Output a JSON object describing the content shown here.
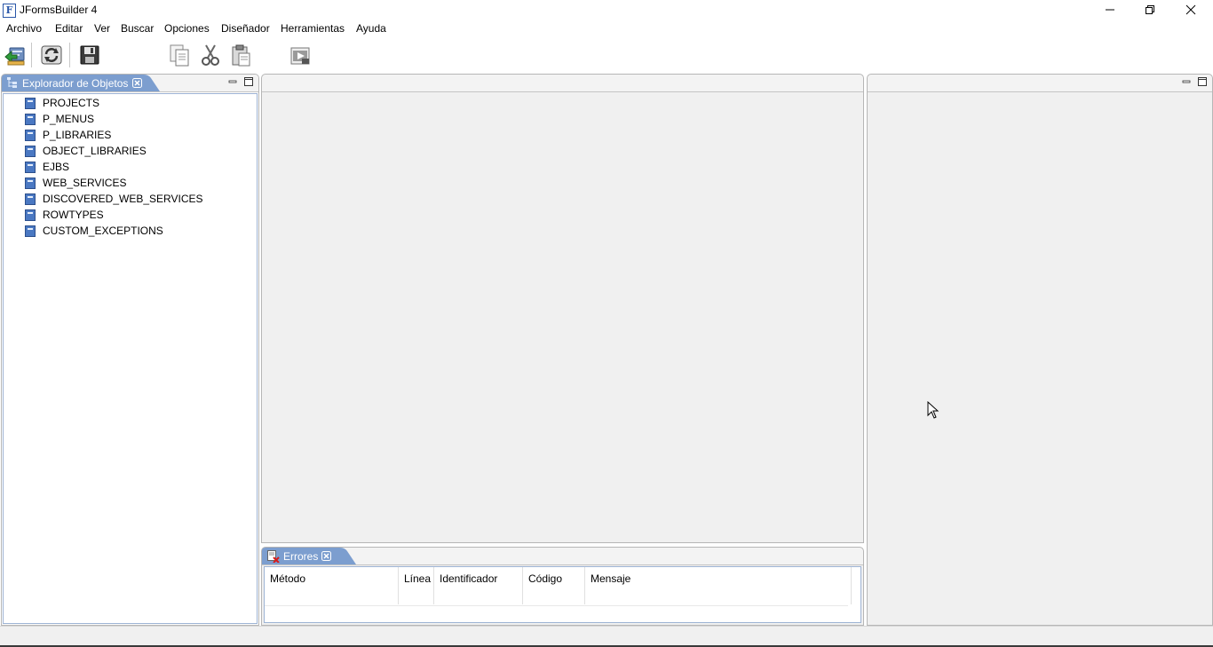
{
  "window": {
    "title": "JFormsBuilder 4",
    "app_icon_letter": "F"
  },
  "menu": {
    "items": [
      "Archivo",
      "Editar",
      "Ver",
      "Buscar",
      "Opciones",
      "Diseñador",
      "Herramientas",
      "Ayuda"
    ]
  },
  "toolbar": {
    "buttons": [
      "open-project-icon",
      "refresh-icon",
      "save-icon",
      "copy-icon",
      "cut-icon",
      "paste-icon",
      "run-form-icon"
    ]
  },
  "explorer": {
    "tab_label": "Explorador de Objetos",
    "items": [
      "PROJECTS",
      "P_MENUS",
      "P_LIBRARIES",
      "OBJECT_LIBRARIES",
      "EJBS",
      "WEB_SERVICES",
      "DISCOVERED_WEB_SERVICES",
      "ROWTYPES",
      "CUSTOM_EXCEPTIONS"
    ]
  },
  "errors": {
    "tab_label": "Errores",
    "columns": [
      "Método",
      "Línea",
      "Identificador",
      "Código",
      "Mensaje"
    ]
  },
  "colors": {
    "tab_active": "#7c9ecf",
    "tree_icon": "#4a78c2",
    "border": "#b6b6b6"
  }
}
